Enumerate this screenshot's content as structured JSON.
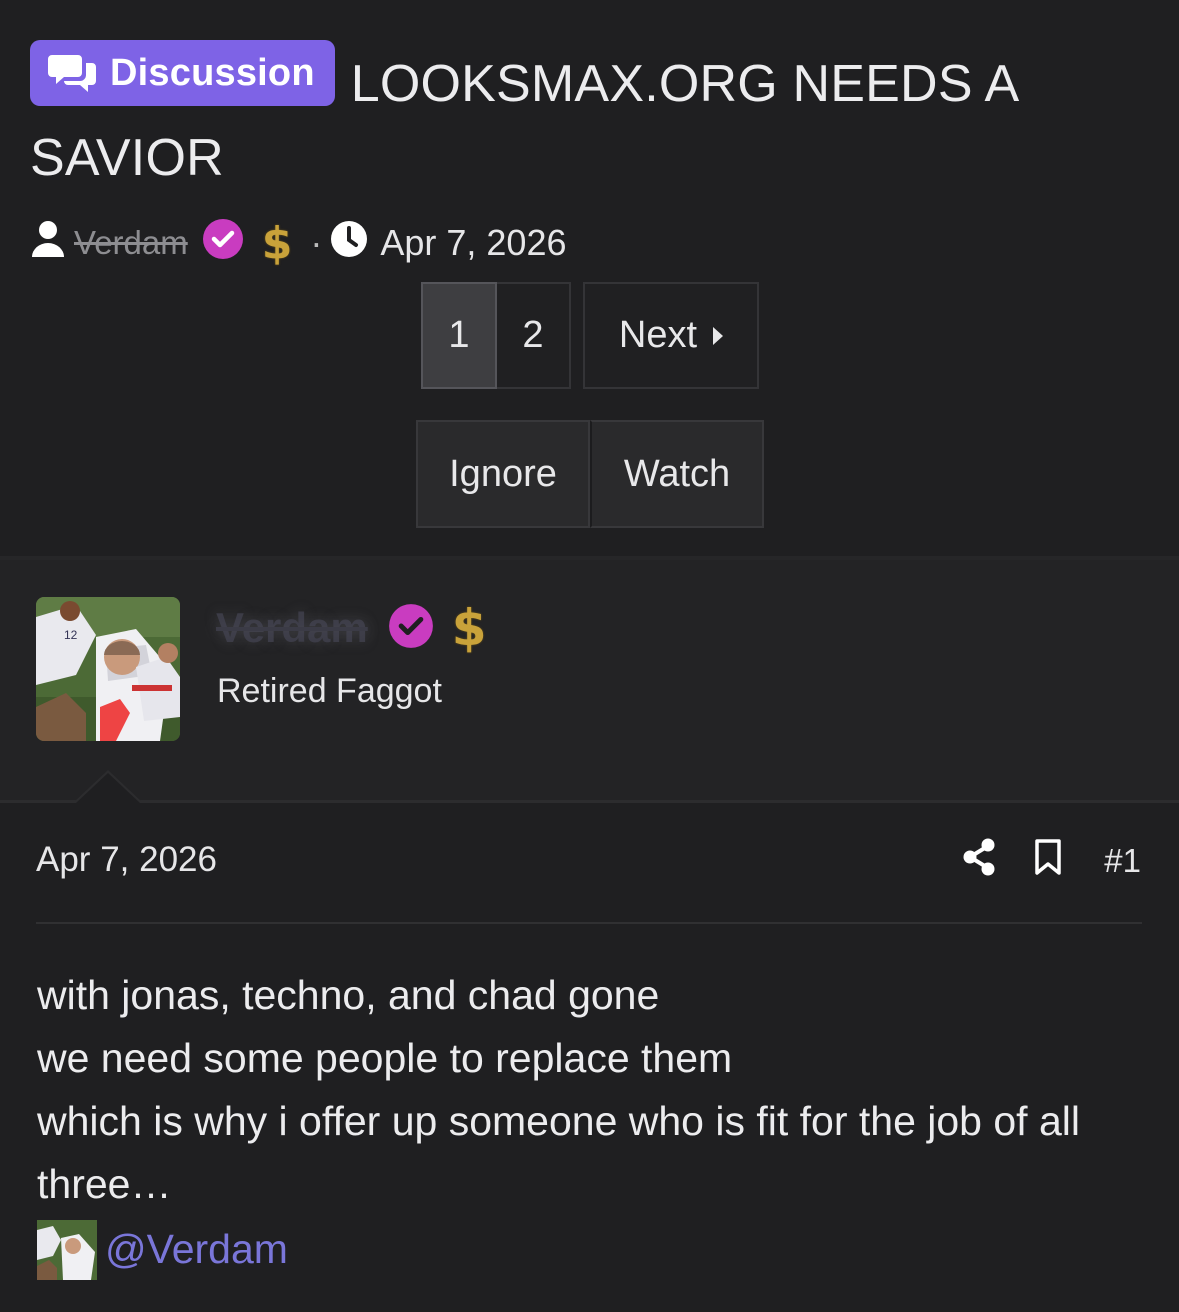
{
  "thread": {
    "prefix_label": "Discussion",
    "title": "LOOKSMAX.ORG NEEDS A SAVIOR",
    "author": "Verdam",
    "date": "Apr 7, 2026"
  },
  "pagination": {
    "pages": [
      "1",
      "2"
    ],
    "current": "1",
    "next_label": "Next"
  },
  "actions": {
    "ignore_label": "Ignore",
    "watch_label": "Watch"
  },
  "post": {
    "username": "Verdam",
    "user_title": "Retired Faggot",
    "date": "Apr 7, 2026",
    "post_number": "#1",
    "body_lines": [
      "with jonas, techno, and chad gone",
      "we need some people to replace them",
      "which is why i offer up someone who is fit for the job of all three…"
    ],
    "mention": "@Verdam"
  },
  "icons": {
    "prefix": "chat-bubbles-icon",
    "user": "user-icon",
    "verified": "verified-check-icon",
    "donor": "dollar-icon",
    "clock": "clock-icon",
    "share": "share-icon",
    "bookmark": "bookmark-icon",
    "next": "caret-right-icon"
  },
  "colors": {
    "background": "#1f1f21",
    "prefix_badge": "#7e63e6",
    "verified": "#c93cc0",
    "dollar": "#c9a23a",
    "mention": "#7a76d9"
  }
}
